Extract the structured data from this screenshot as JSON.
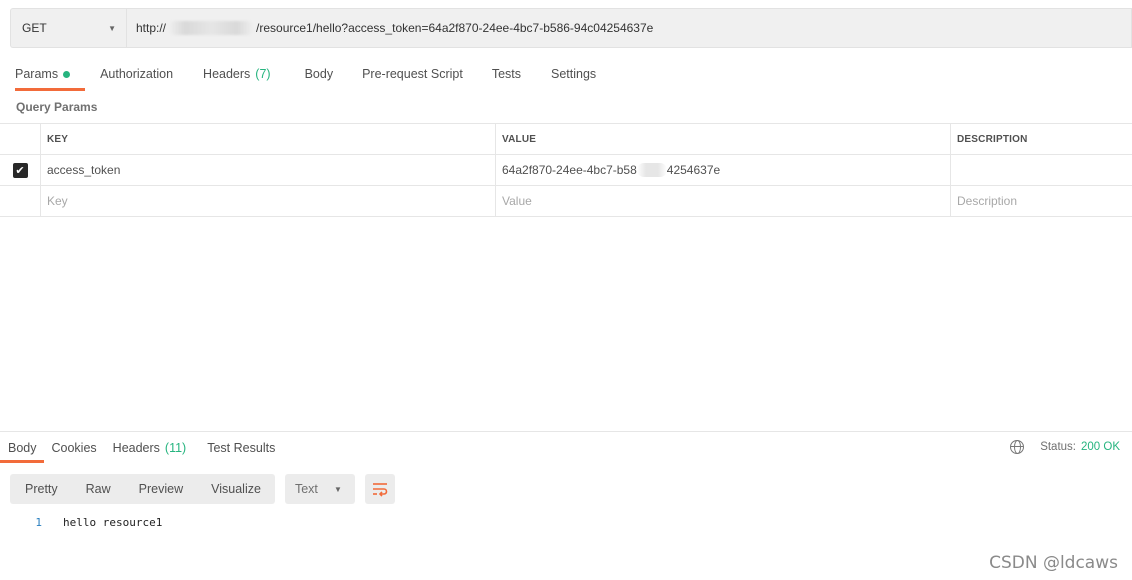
{
  "request": {
    "method": "GET",
    "url_prefix": "http://",
    "url_suffix": "/resource1/hello?access_token=64a2f870-24ee-4bc7-b586-94c04254637e"
  },
  "tabs": [
    {
      "label": "Params",
      "active": true,
      "dot": true
    },
    {
      "label": "Authorization"
    },
    {
      "label": "Headers",
      "count": "(7)"
    },
    {
      "label": "Body"
    },
    {
      "label": "Pre-request Script"
    },
    {
      "label": "Tests"
    },
    {
      "label": "Settings"
    }
  ],
  "params": {
    "title": "Query Params",
    "headers": {
      "key": "KEY",
      "value": "VALUE",
      "description": "DESCRIPTION"
    },
    "rows": [
      {
        "checked": true,
        "key": "access_token",
        "value_prefix": "64a2f870-24ee-4bc7-b58",
        "value_suffix": "4254637e",
        "description": ""
      }
    ],
    "placeholders": {
      "key": "Key",
      "value": "Value",
      "description": "Description"
    }
  },
  "response": {
    "tabs": [
      {
        "label": "Body",
        "active": true
      },
      {
        "label": "Cookies"
      },
      {
        "label": "Headers",
        "count": "(11)"
      },
      {
        "label": "Test Results"
      }
    ],
    "status_label": "Status:",
    "status_value": "200 OK",
    "views": [
      "Pretty",
      "Raw",
      "Preview",
      "Visualize"
    ],
    "format": "Text",
    "lines": [
      {
        "num": "1",
        "text": "hello resource1"
      }
    ]
  },
  "watermark": "CSDN @ldcaws",
  "colors": {
    "accent": "#f26b3a",
    "success": "#26b47f"
  }
}
